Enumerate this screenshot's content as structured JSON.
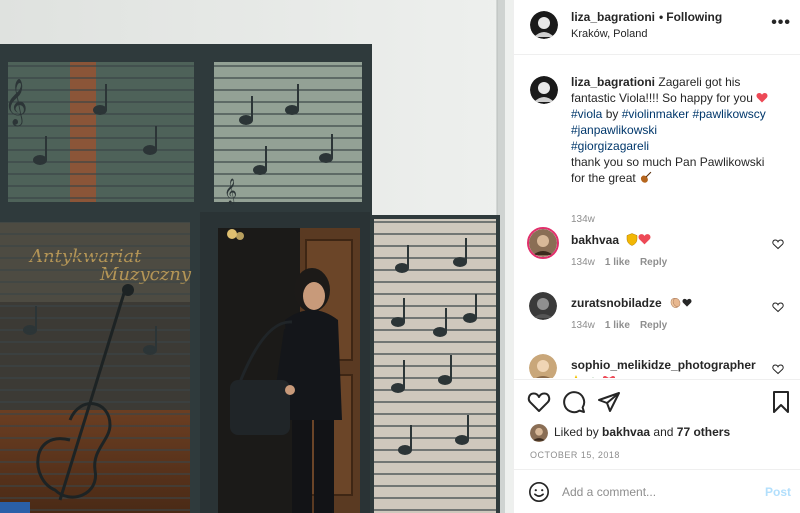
{
  "header": {
    "username": "liza_bagrationi",
    "separator": "•",
    "follow_label": "Following",
    "location": "Kraków, Poland",
    "more_icon": "more-options-icon",
    "more_glyph": "•••"
  },
  "photo": {
    "alt": "Musician with bag standing in a doorway of a shop with musical-note window grilles",
    "sign_text": "Antykwariat Muzyczny"
  },
  "caption": {
    "username": "liza_bagrationi",
    "text_1": "Zagareli got his fantastic Viola!!!! So happy for you",
    "tag_1": "#viola",
    "text_2": "by",
    "tag_2": "#violinmaker",
    "tag_3": "#pawlikowscy",
    "tag_4": "#janpawlikowski",
    "tag_5": "#giorgizagareli",
    "text_3": "thank you so much Pan Pawlikowski for the great",
    "time": "134w"
  },
  "comments": [
    {
      "username": "bakhvaa",
      "time": "134w",
      "likes": "1 like",
      "reply": "Reply",
      "emoji": "shield-heart"
    },
    {
      "username": "zuratsnobiladze",
      "time": "134w",
      "likes": "1 like",
      "reply": "Reply",
      "emoji": "clap-heart"
    },
    {
      "username": "sophio_melikidze_photographer",
      "time": "",
      "likes": "",
      "reply": "",
      "emoji": "sparkles"
    }
  ],
  "actions": {
    "like_icon": "heart-icon",
    "comment_icon": "comment-icon",
    "share_icon": "share-icon",
    "save_icon": "bookmark-icon",
    "liked_by_prefix": "Liked by",
    "liked_by_user": "bakhvaa",
    "liked_by_and": "and",
    "liked_by_others": "77 others",
    "date": "OCTOBER 15, 2018"
  },
  "add_comment": {
    "placeholder": "Add a comment...",
    "post_label": "Post"
  },
  "colors": {
    "link": "#00376b",
    "meta": "#8e8e8e",
    "post_disabled": "#b2dffc",
    "like_red": "#ed4956",
    "frame": "#2f3a3c"
  }
}
